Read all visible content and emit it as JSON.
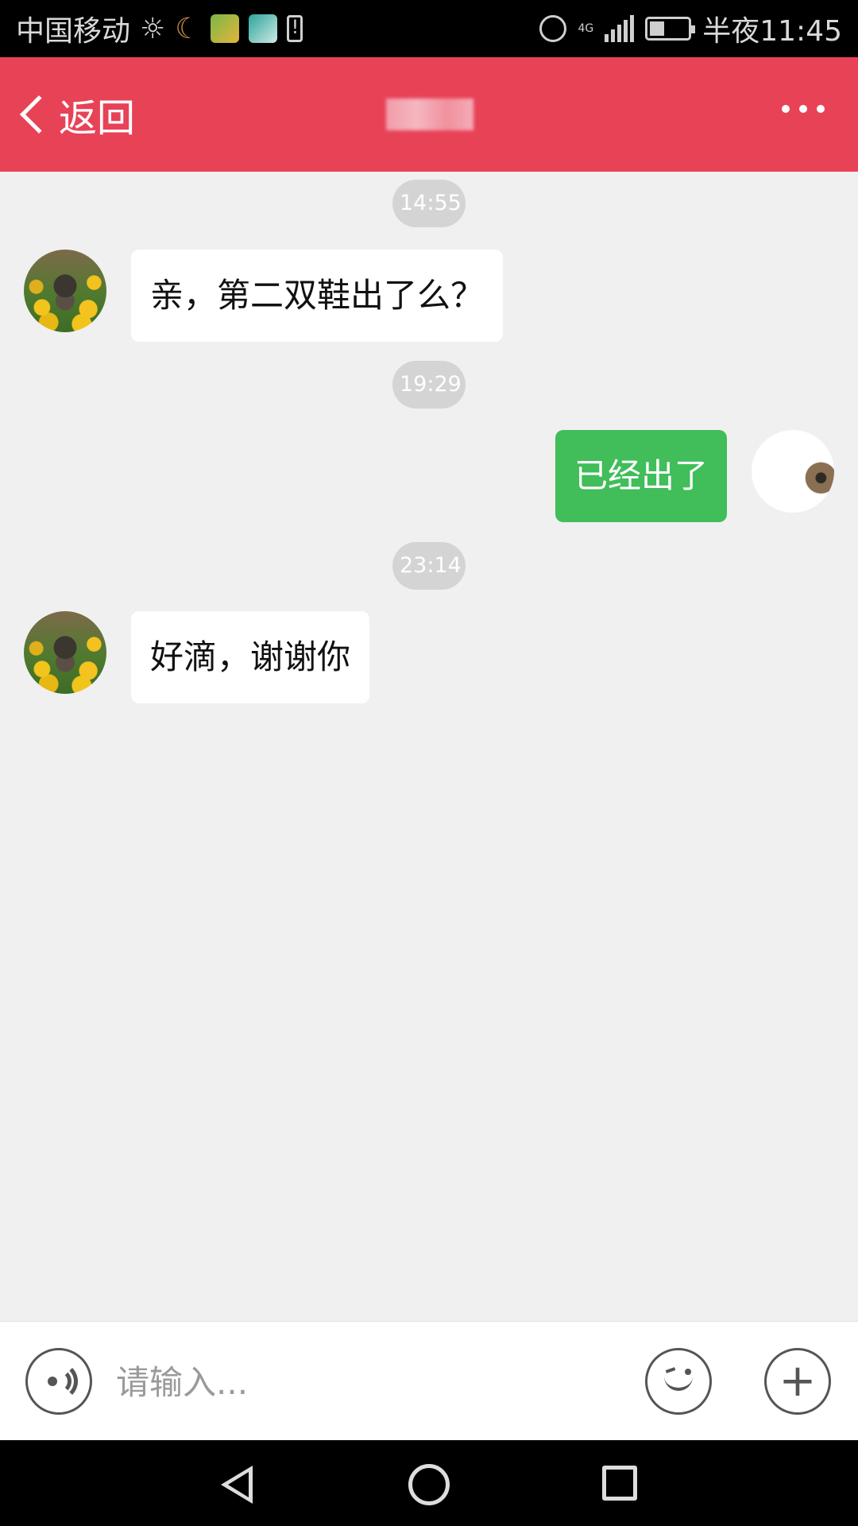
{
  "status_bar": {
    "carrier": "中国移动",
    "time": "半夜11:45",
    "network": "4G"
  },
  "header": {
    "back_label": "返回"
  },
  "messages": [
    {
      "type": "timestamp",
      "text": "14:55"
    },
    {
      "type": "incoming",
      "text": "亲，第二双鞋出了么？"
    },
    {
      "type": "timestamp",
      "text": "19:29"
    },
    {
      "type": "outgoing",
      "text": "已经出了"
    },
    {
      "type": "timestamp",
      "text": "23:14"
    },
    {
      "type": "incoming",
      "text": "好滴，谢谢你"
    }
  ],
  "input_bar": {
    "placeholder": "请输入...",
    "value": ""
  },
  "colors": {
    "header_bg": "#e84257",
    "outgoing_bubble": "#41bd5a",
    "incoming_bubble": "#ffffff",
    "chat_bg": "#f0f0f0"
  },
  "icons": {
    "back": "chevron-left-icon",
    "more": "more-dots-icon",
    "voice": "voice-icon",
    "emoji": "emoji-icon",
    "plus": "plus-icon"
  }
}
